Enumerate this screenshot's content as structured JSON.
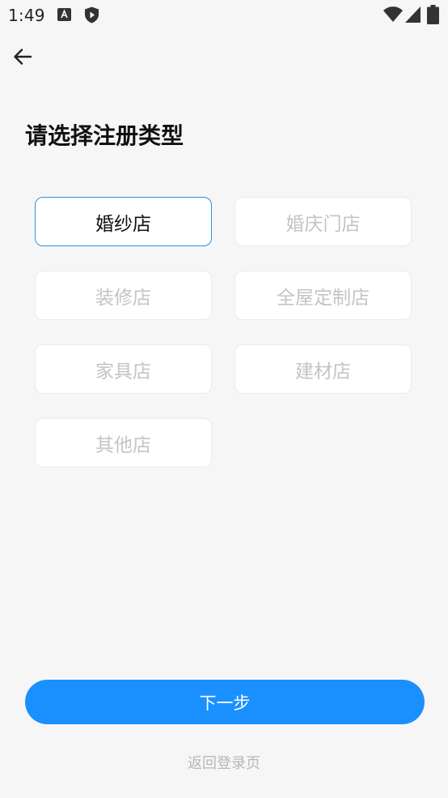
{
  "status_bar": {
    "time": "1:49",
    "icons": [
      "a-notification-icon",
      "play-protect-icon",
      "wifi-icon",
      "signal-icon",
      "battery-icon"
    ]
  },
  "header": {
    "back_icon": "arrow-left-icon",
    "title": "请选择注册类型"
  },
  "options": [
    {
      "label": "婚纱店",
      "selected": true
    },
    {
      "label": "婚庆门店",
      "selected": false
    },
    {
      "label": "装修店",
      "selected": false
    },
    {
      "label": "全屋定制店",
      "selected": false
    },
    {
      "label": "家具店",
      "selected": false
    },
    {
      "label": "建材店",
      "selected": false
    },
    {
      "label": "其他店",
      "selected": false
    }
  ],
  "footer": {
    "next_label": "下一步",
    "back_to_login_label": "返回登录页"
  },
  "colors": {
    "accent": "#1a90ff",
    "selected_border": "#2f8fe8",
    "background": "#f6f6f7",
    "inactive_text": "#c4c4c4"
  }
}
